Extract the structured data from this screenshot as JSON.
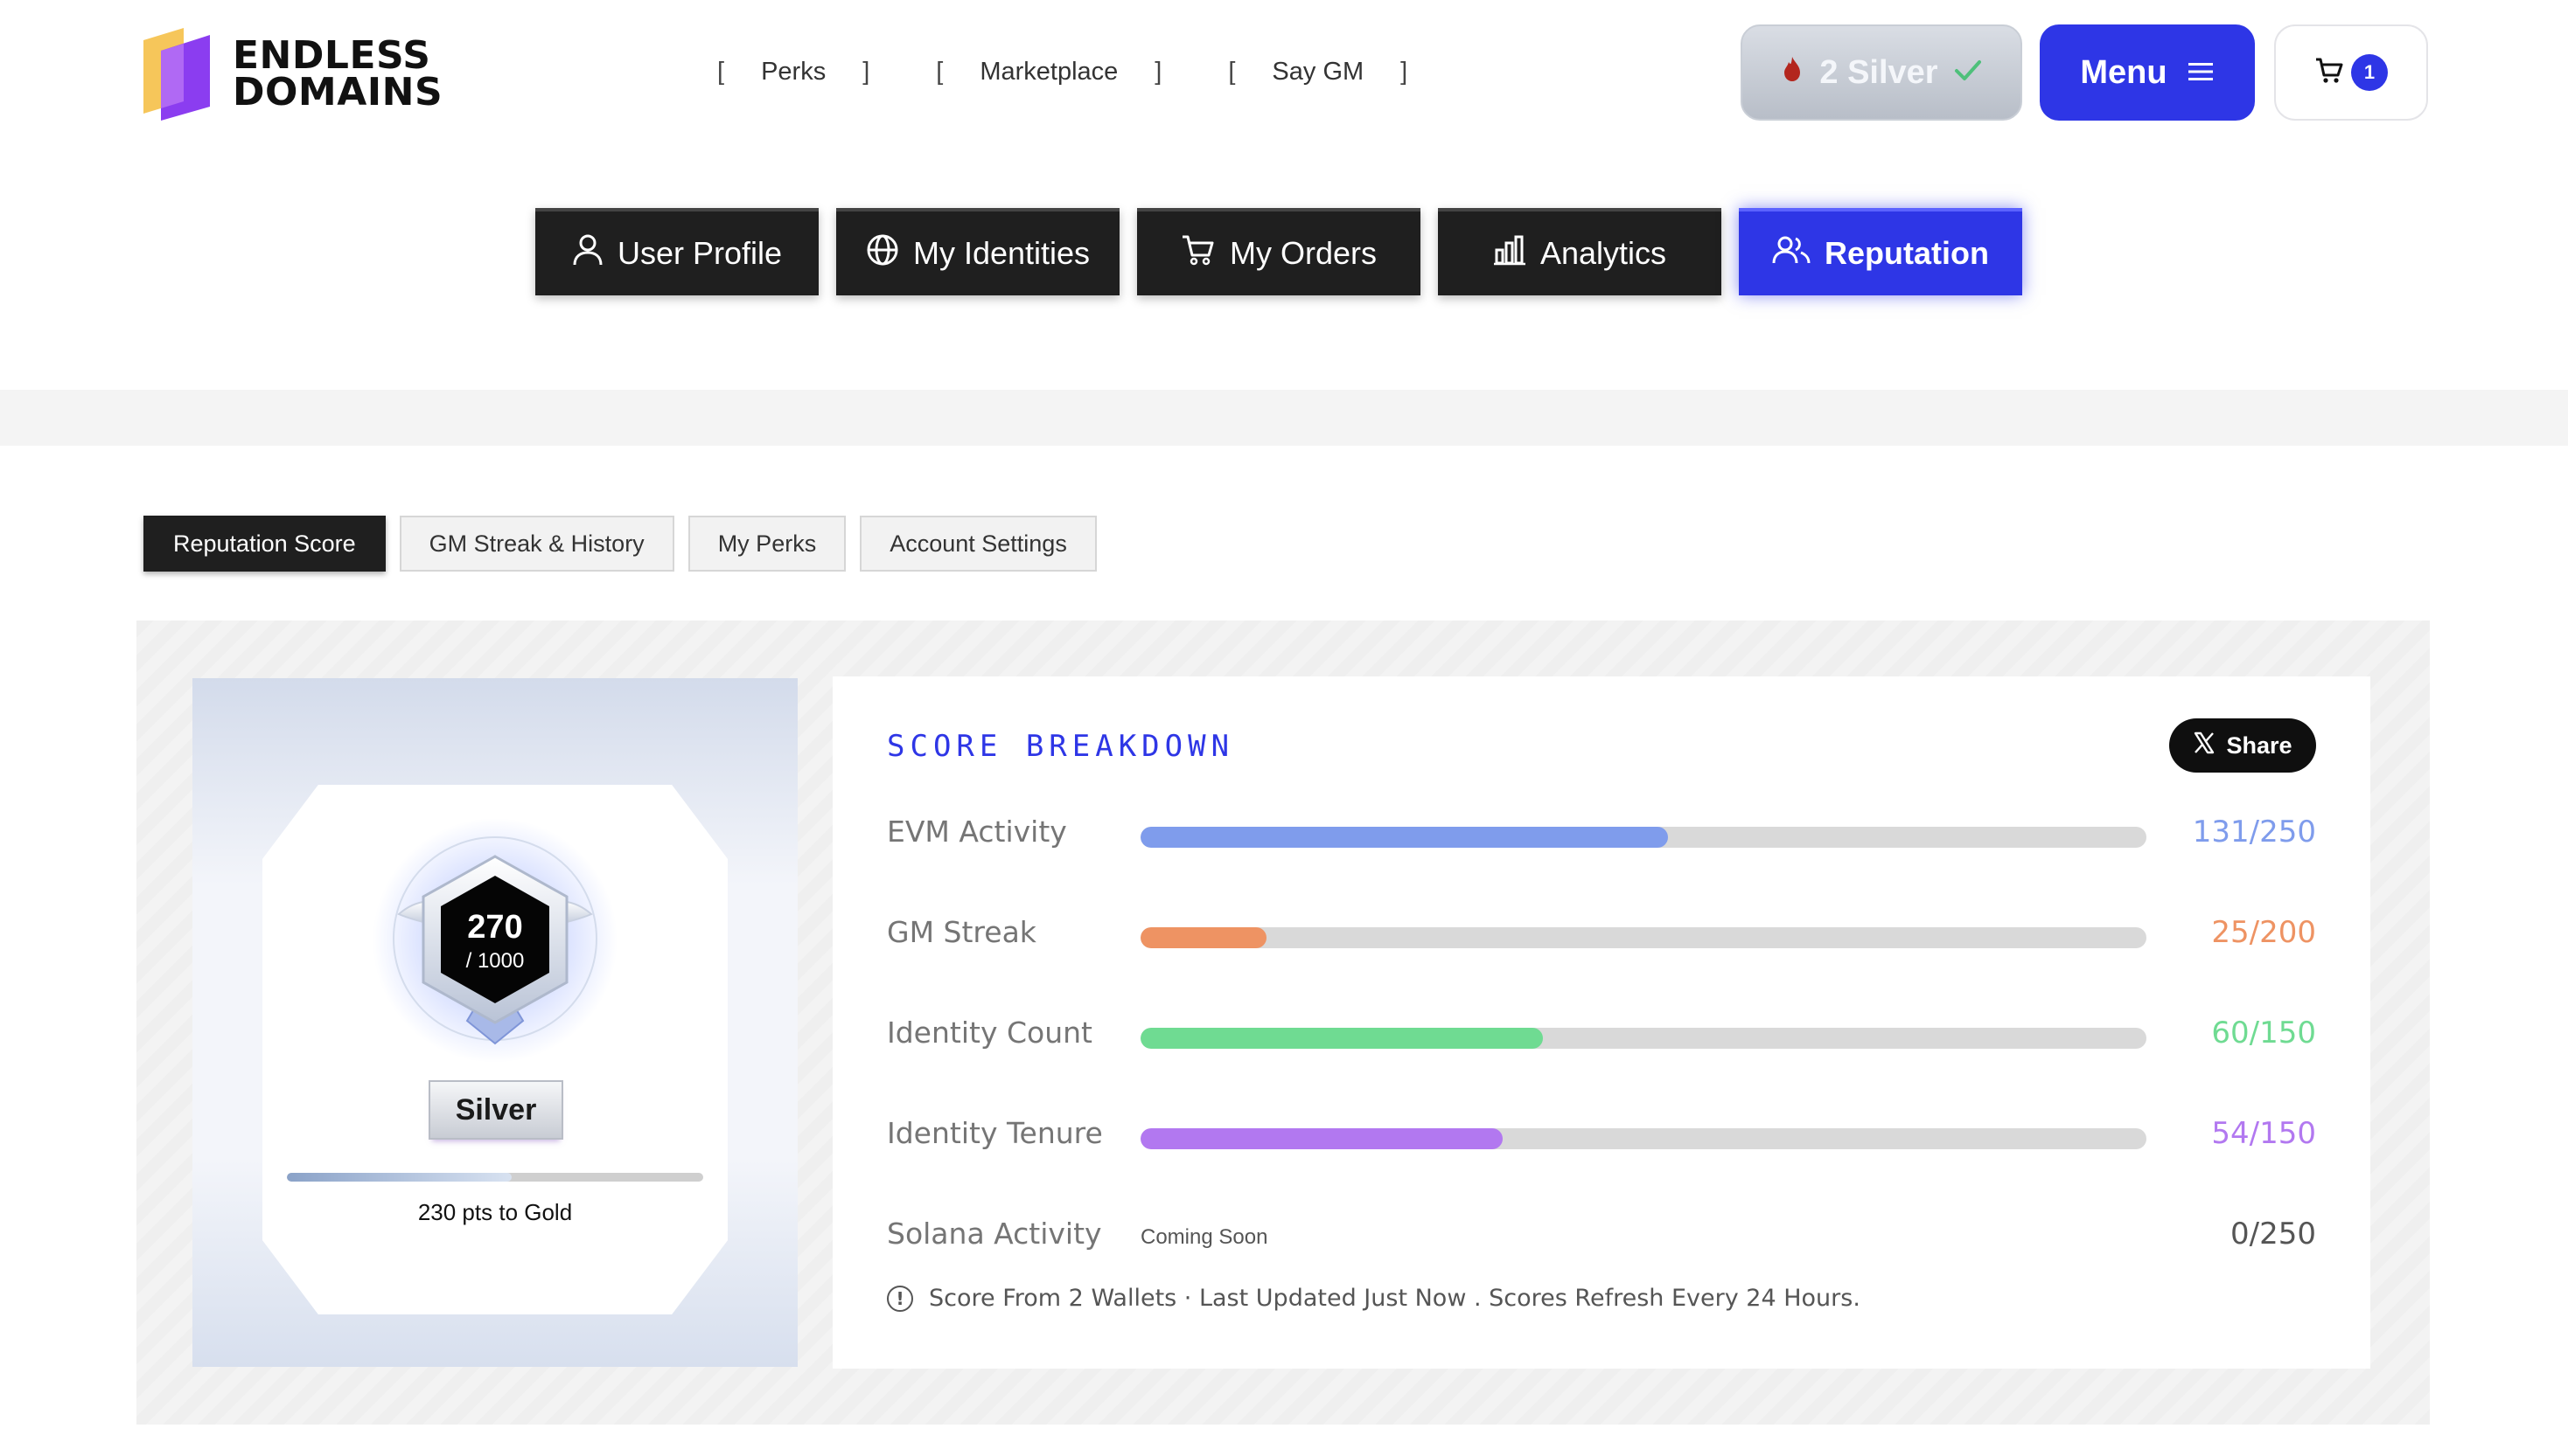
{
  "header": {
    "logo_line1": "ENDLESS",
    "logo_line2": "DOMAINS",
    "nav": [
      {
        "label": "Perks"
      },
      {
        "label": "Marketplace"
      },
      {
        "label": "Say GM"
      }
    ],
    "tier_pill": {
      "label": "2 Silver",
      "icon": "fire-icon",
      "check_icon": "check-icon"
    },
    "menu_label": "Menu",
    "cart_count": "1"
  },
  "main_tabs": [
    {
      "label": "User Profile",
      "icon": "user-icon",
      "active": false
    },
    {
      "label": "My Identities",
      "icon": "globe-icon",
      "active": false
    },
    {
      "label": "My Orders",
      "icon": "cart-icon",
      "active": false
    },
    {
      "label": "Analytics",
      "icon": "bar-chart-icon",
      "active": false
    },
    {
      "label": "Reputation",
      "icon": "users-icon",
      "active": true
    }
  ],
  "sub_tabs": [
    {
      "label": "Reputation Score",
      "active": true
    },
    {
      "label": "GM Streak & History",
      "active": false
    },
    {
      "label": "My Perks",
      "active": false
    },
    {
      "label": "Account Settings",
      "active": false
    }
  ],
  "rank": {
    "score": "270",
    "max": "/ 1000",
    "tier": "Silver",
    "progress_to_next": 0.54,
    "pts_to_next": "230 pts to Gold"
  },
  "breakdown": {
    "title": "SCORE BREAKDOWN",
    "share_label": "Share",
    "rows": [
      {
        "label": "EVM Activity",
        "value": "131/250",
        "fraction": 0.524,
        "color": "#7f9cec"
      },
      {
        "label": "GM Streak",
        "value": "25/200",
        "fraction": 0.125,
        "color": "#ee9363"
      },
      {
        "label": "Identity Count",
        "value": "60/150",
        "fraction": 0.4,
        "color": "#6fdb92"
      },
      {
        "label": "Identity Tenure",
        "value": "54/150",
        "fraction": 0.36,
        "color": "#b278f0"
      },
      {
        "label": "Solana Activity",
        "value": "0/250",
        "fraction": 0,
        "color": "#555555",
        "note": "Coming Soon"
      }
    ],
    "footnote": "Score From 2 Wallets · Last Updated Just Now . Scores Refresh Every 24 Hours."
  }
}
